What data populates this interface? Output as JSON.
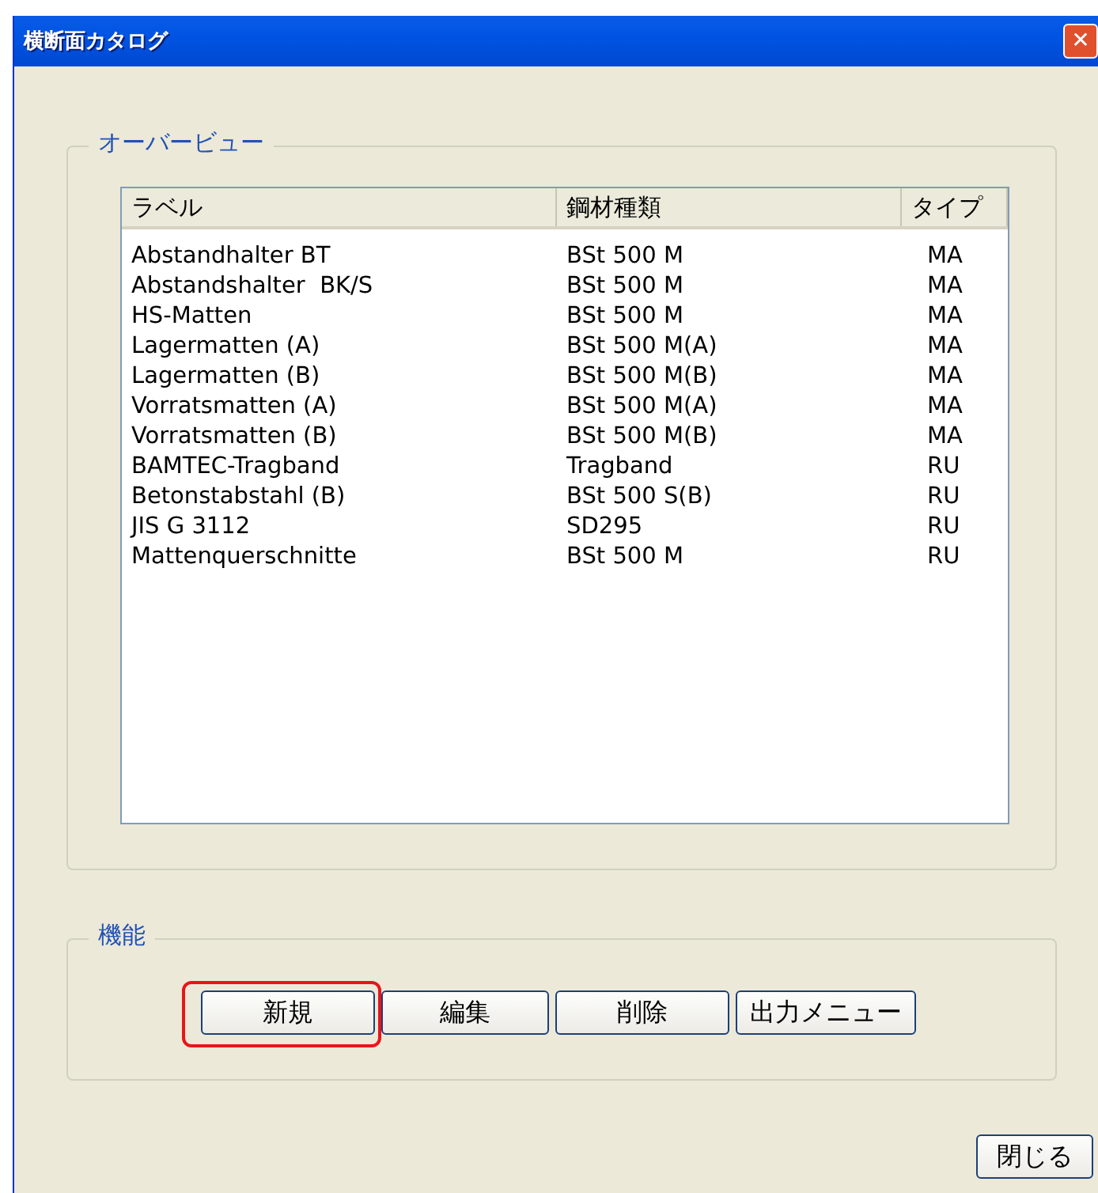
{
  "window": {
    "title": "横断面カタログ",
    "close_glyph": "✕"
  },
  "overview": {
    "title": "オーバービュー",
    "columns": [
      "ラベル",
      "鋼材種類",
      "タイプ"
    ],
    "rows": [
      [
        "Abstandhalter BT",
        "BSt 500 M",
        "MA"
      ],
      [
        "Abstandshalter  BK/S",
        "BSt 500 M",
        "MA"
      ],
      [
        "HS-Matten",
        "BSt 500 M",
        "MA"
      ],
      [
        "Lagermatten (A)",
        "BSt 500 M(A)",
        "MA"
      ],
      [
        "Lagermatten (B)",
        "BSt 500 M(B)",
        "MA"
      ],
      [
        "Vorratsmatten (A)",
        "BSt 500 M(A)",
        "MA"
      ],
      [
        "Vorratsmatten (B)",
        "BSt 500 M(B)",
        "MA"
      ],
      [
        "BAMTEC-Tragband",
        "Tragband",
        "RU"
      ],
      [
        "Betonstabstahl (B)",
        "BSt 500 S(B)",
        "RU"
      ],
      [
        "JIS G 3112",
        "SD295",
        "RU"
      ],
      [
        "Mattenquerschnitte",
        "BSt 500 M",
        "RU"
      ]
    ]
  },
  "functions": {
    "title": "機能",
    "buttons": [
      {
        "label": "新規",
        "highlighted": true
      },
      {
        "label": "編集",
        "highlighted": false
      },
      {
        "label": "削除",
        "highlighted": false
      },
      {
        "label": "出力メニュー",
        "highlighted": false
      }
    ]
  },
  "close_button": "閉じる"
}
